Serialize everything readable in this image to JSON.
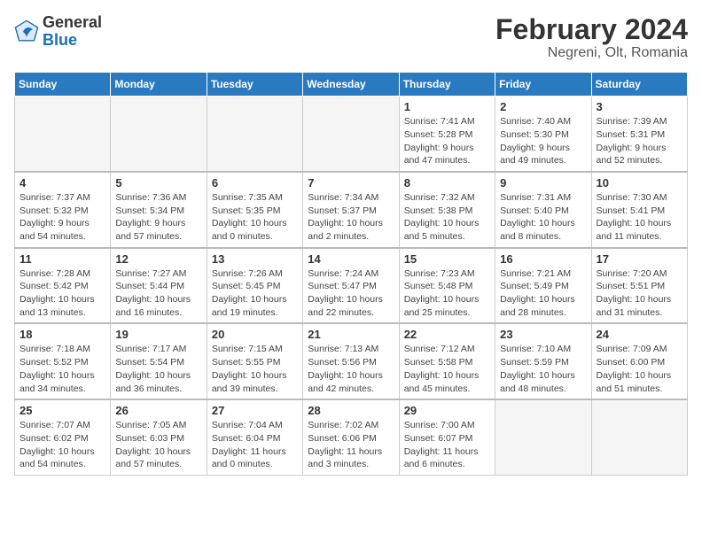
{
  "header": {
    "logo_general": "General",
    "logo_blue": "Blue",
    "title": "February 2024",
    "subtitle": "Negreni, Olt, Romania"
  },
  "days_of_week": [
    "Sunday",
    "Monday",
    "Tuesday",
    "Wednesday",
    "Thursday",
    "Friday",
    "Saturday"
  ],
  "weeks": [
    [
      {
        "day": "",
        "info": "",
        "empty": true
      },
      {
        "day": "",
        "info": "",
        "empty": true
      },
      {
        "day": "",
        "info": "",
        "empty": true
      },
      {
        "day": "",
        "info": "",
        "empty": true
      },
      {
        "day": "1",
        "info": "Sunrise: 7:41 AM\nSunset: 5:28 PM\nDaylight: 9 hours\nand 47 minutes."
      },
      {
        "day": "2",
        "info": "Sunrise: 7:40 AM\nSunset: 5:30 PM\nDaylight: 9 hours\nand 49 minutes."
      },
      {
        "day": "3",
        "info": "Sunrise: 7:39 AM\nSunset: 5:31 PM\nDaylight: 9 hours\nand 52 minutes."
      }
    ],
    [
      {
        "day": "4",
        "info": "Sunrise: 7:37 AM\nSunset: 5:32 PM\nDaylight: 9 hours\nand 54 minutes."
      },
      {
        "day": "5",
        "info": "Sunrise: 7:36 AM\nSunset: 5:34 PM\nDaylight: 9 hours\nand 57 minutes."
      },
      {
        "day": "6",
        "info": "Sunrise: 7:35 AM\nSunset: 5:35 PM\nDaylight: 10 hours\nand 0 minutes."
      },
      {
        "day": "7",
        "info": "Sunrise: 7:34 AM\nSunset: 5:37 PM\nDaylight: 10 hours\nand 2 minutes."
      },
      {
        "day": "8",
        "info": "Sunrise: 7:32 AM\nSunset: 5:38 PM\nDaylight: 10 hours\nand 5 minutes."
      },
      {
        "day": "9",
        "info": "Sunrise: 7:31 AM\nSunset: 5:40 PM\nDaylight: 10 hours\nand 8 minutes."
      },
      {
        "day": "10",
        "info": "Sunrise: 7:30 AM\nSunset: 5:41 PM\nDaylight: 10 hours\nand 11 minutes."
      }
    ],
    [
      {
        "day": "11",
        "info": "Sunrise: 7:28 AM\nSunset: 5:42 PM\nDaylight: 10 hours\nand 13 minutes."
      },
      {
        "day": "12",
        "info": "Sunrise: 7:27 AM\nSunset: 5:44 PM\nDaylight: 10 hours\nand 16 minutes."
      },
      {
        "day": "13",
        "info": "Sunrise: 7:26 AM\nSunset: 5:45 PM\nDaylight: 10 hours\nand 19 minutes."
      },
      {
        "day": "14",
        "info": "Sunrise: 7:24 AM\nSunset: 5:47 PM\nDaylight: 10 hours\nand 22 minutes."
      },
      {
        "day": "15",
        "info": "Sunrise: 7:23 AM\nSunset: 5:48 PM\nDaylight: 10 hours\nand 25 minutes."
      },
      {
        "day": "16",
        "info": "Sunrise: 7:21 AM\nSunset: 5:49 PM\nDaylight: 10 hours\nand 28 minutes."
      },
      {
        "day": "17",
        "info": "Sunrise: 7:20 AM\nSunset: 5:51 PM\nDaylight: 10 hours\nand 31 minutes."
      }
    ],
    [
      {
        "day": "18",
        "info": "Sunrise: 7:18 AM\nSunset: 5:52 PM\nDaylight: 10 hours\nand 34 minutes."
      },
      {
        "day": "19",
        "info": "Sunrise: 7:17 AM\nSunset: 5:54 PM\nDaylight: 10 hours\nand 36 minutes."
      },
      {
        "day": "20",
        "info": "Sunrise: 7:15 AM\nSunset: 5:55 PM\nDaylight: 10 hours\nand 39 minutes."
      },
      {
        "day": "21",
        "info": "Sunrise: 7:13 AM\nSunset: 5:56 PM\nDaylight: 10 hours\nand 42 minutes."
      },
      {
        "day": "22",
        "info": "Sunrise: 7:12 AM\nSunset: 5:58 PM\nDaylight: 10 hours\nand 45 minutes."
      },
      {
        "day": "23",
        "info": "Sunrise: 7:10 AM\nSunset: 5:59 PM\nDaylight: 10 hours\nand 48 minutes."
      },
      {
        "day": "24",
        "info": "Sunrise: 7:09 AM\nSunset: 6:00 PM\nDaylight: 10 hours\nand 51 minutes."
      }
    ],
    [
      {
        "day": "25",
        "info": "Sunrise: 7:07 AM\nSunset: 6:02 PM\nDaylight: 10 hours\nand 54 minutes."
      },
      {
        "day": "26",
        "info": "Sunrise: 7:05 AM\nSunset: 6:03 PM\nDaylight: 10 hours\nand 57 minutes."
      },
      {
        "day": "27",
        "info": "Sunrise: 7:04 AM\nSunset: 6:04 PM\nDaylight: 11 hours\nand 0 minutes."
      },
      {
        "day": "28",
        "info": "Sunrise: 7:02 AM\nSunset: 6:06 PM\nDaylight: 11 hours\nand 3 minutes."
      },
      {
        "day": "29",
        "info": "Sunrise: 7:00 AM\nSunset: 6:07 PM\nDaylight: 11 hours\nand 6 minutes."
      },
      {
        "day": "",
        "info": "",
        "empty": true
      },
      {
        "day": "",
        "info": "",
        "empty": true
      }
    ]
  ]
}
